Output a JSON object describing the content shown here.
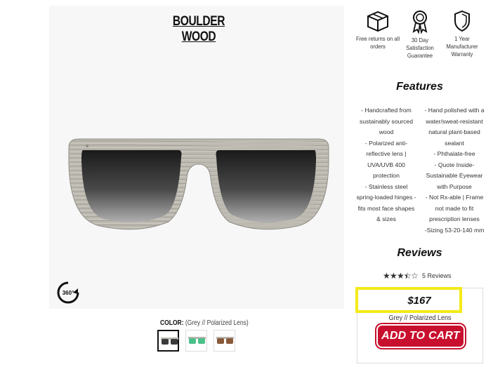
{
  "product": {
    "title": "BOULDER WOOD"
  },
  "benefits": [
    {
      "icon": "box-icon",
      "text": "Free returns on all orders"
    },
    {
      "icon": "award-ribbon-icon",
      "text": "30 Day Satisfaction Guarantee"
    },
    {
      "icon": "shield-icon",
      "text": "1 Year Manufacturer Warranty"
    }
  ],
  "features": {
    "title": "Features",
    "left": [
      "- Handcrafted from sustainably sourced wood",
      "- Polarized anti-reflective lens | UVA/UVB 400 protection",
      "- Stainless steel spring-loaded hinges - fits most face shapes & sizes"
    ],
    "right": [
      "- Hand polished with a water/sweat-resistant natural plant-based sealant",
      "- Phthalate-free",
      "- Quote Inside- Sustainable Eyewear with Purpose",
      "- Not Rx-able | Frame not made to fit prescription lenses",
      "-Sizing 53-20-140 mm"
    ]
  },
  "reviews": {
    "title": "Reviews",
    "rating": 3.5,
    "max": 5,
    "count_label": "5 Reviews"
  },
  "color": {
    "label": "COLOR:",
    "value": "(Grey // Polarized Lens)",
    "swatches": [
      {
        "name": "Grey",
        "lens": "#3a3a3a",
        "frame": "#b9b6ae",
        "selected": true
      },
      {
        "name": "Green",
        "lens": "#4cc08a",
        "frame": "#b9b6ae",
        "selected": false
      },
      {
        "name": "Brown",
        "lens": "#8a5a3a",
        "frame": "#b9b6ae",
        "selected": false
      }
    ]
  },
  "purchase": {
    "price": "$167",
    "variant": "Grey // Polarized Lens",
    "add_to_cart": "ADD TO CART"
  },
  "icons": {
    "rotate": "rotate-360-icon",
    "rotate_label": "360°"
  },
  "colors": {
    "accent": "#c8102e",
    "highlight": "#f5ea1a"
  }
}
